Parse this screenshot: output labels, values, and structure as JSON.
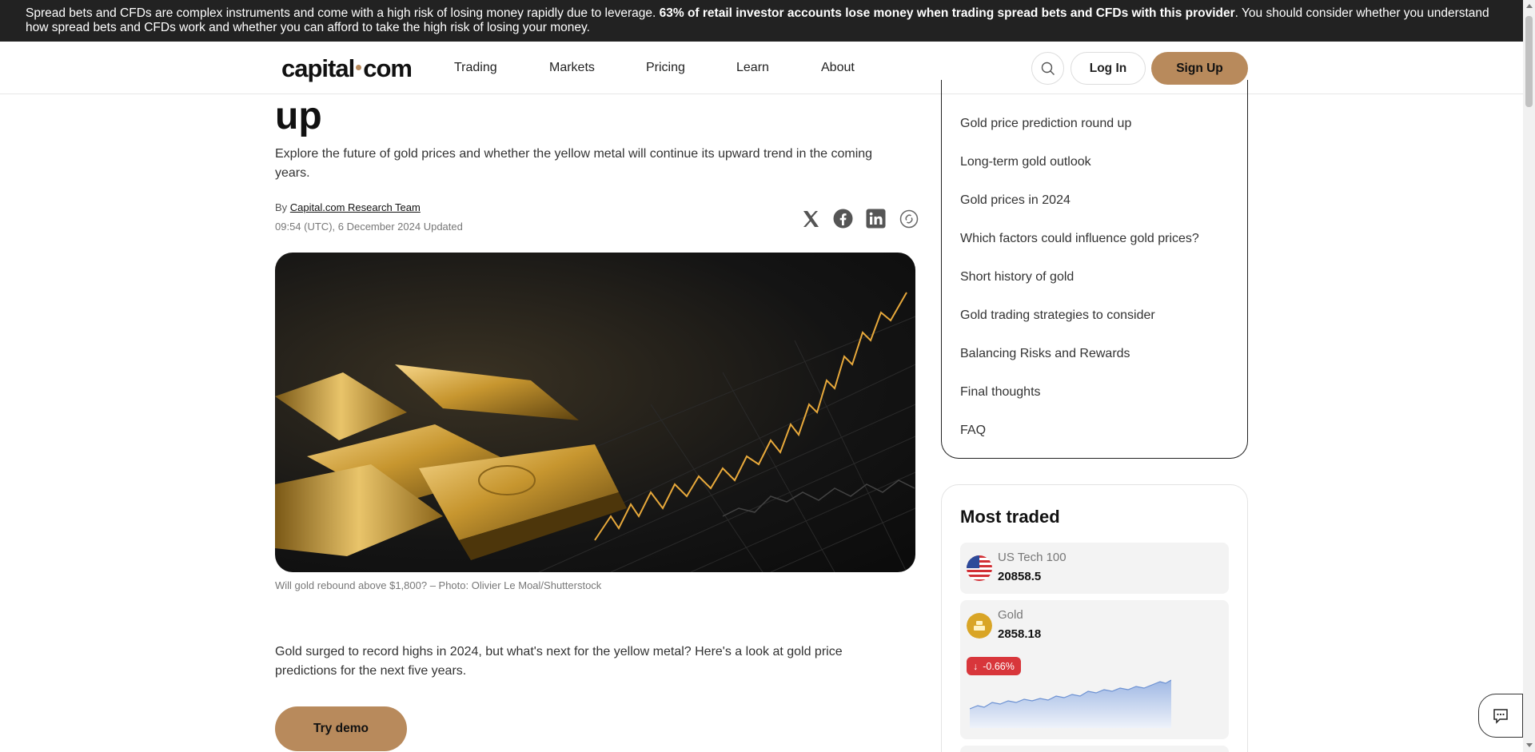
{
  "risk_banner": {
    "text_start": "Spread bets and CFDs are complex instruments and come with a high risk of losing money rapidly due to leverage. ",
    "text_bold": "63% of retail investor accounts lose money when trading spread bets and CFDs with this provider",
    "text_end": ". You should consider whether you understand how spread bets and CFDs work and whether you can afford to take the high risk of losing your money."
  },
  "header": {
    "logo_left": "capital",
    "logo_right": "com",
    "nav": [
      "Trading",
      "Markets",
      "Pricing",
      "Learn",
      "About"
    ],
    "login_label": "Log In",
    "signup_label": "Sign Up"
  },
  "article": {
    "title_tail": "up",
    "subtitle": "Explore the future of gold prices and whether the yellow metal will continue its upward trend in the coming years.",
    "by_label": "By",
    "author": "Capital.com Research Team",
    "date": "09:54 (UTC), 6 December 2024 Updated",
    "caption": "Will gold rebound above $1,800? – Photo: Olivier Le Moal/Shutterstock",
    "intro": "Gold surged to record highs in 2024, but what's next for the yellow metal? Here's a look at gold price predictions for the next five years.",
    "demo_label": "Try demo"
  },
  "toc": {
    "items": [
      "Gold price prediction round up",
      "Long-term gold outlook",
      "Gold prices in 2024",
      "Which factors could influence gold prices?",
      "Short history of gold",
      "Gold trading strategies to consider",
      "Balancing Risks and Rewards",
      "Final thoughts",
      "FAQ"
    ]
  },
  "most_traded": {
    "title": "Most traded",
    "items": [
      {
        "name": "US Tech 100",
        "price": "20858.5"
      },
      {
        "name": "Gold",
        "price": "2858.18",
        "change": "-0.66%"
      }
    ]
  },
  "colors": {
    "accent": "#b88a5c",
    "banner_bg": "#222222",
    "negative": "#d8363b"
  }
}
